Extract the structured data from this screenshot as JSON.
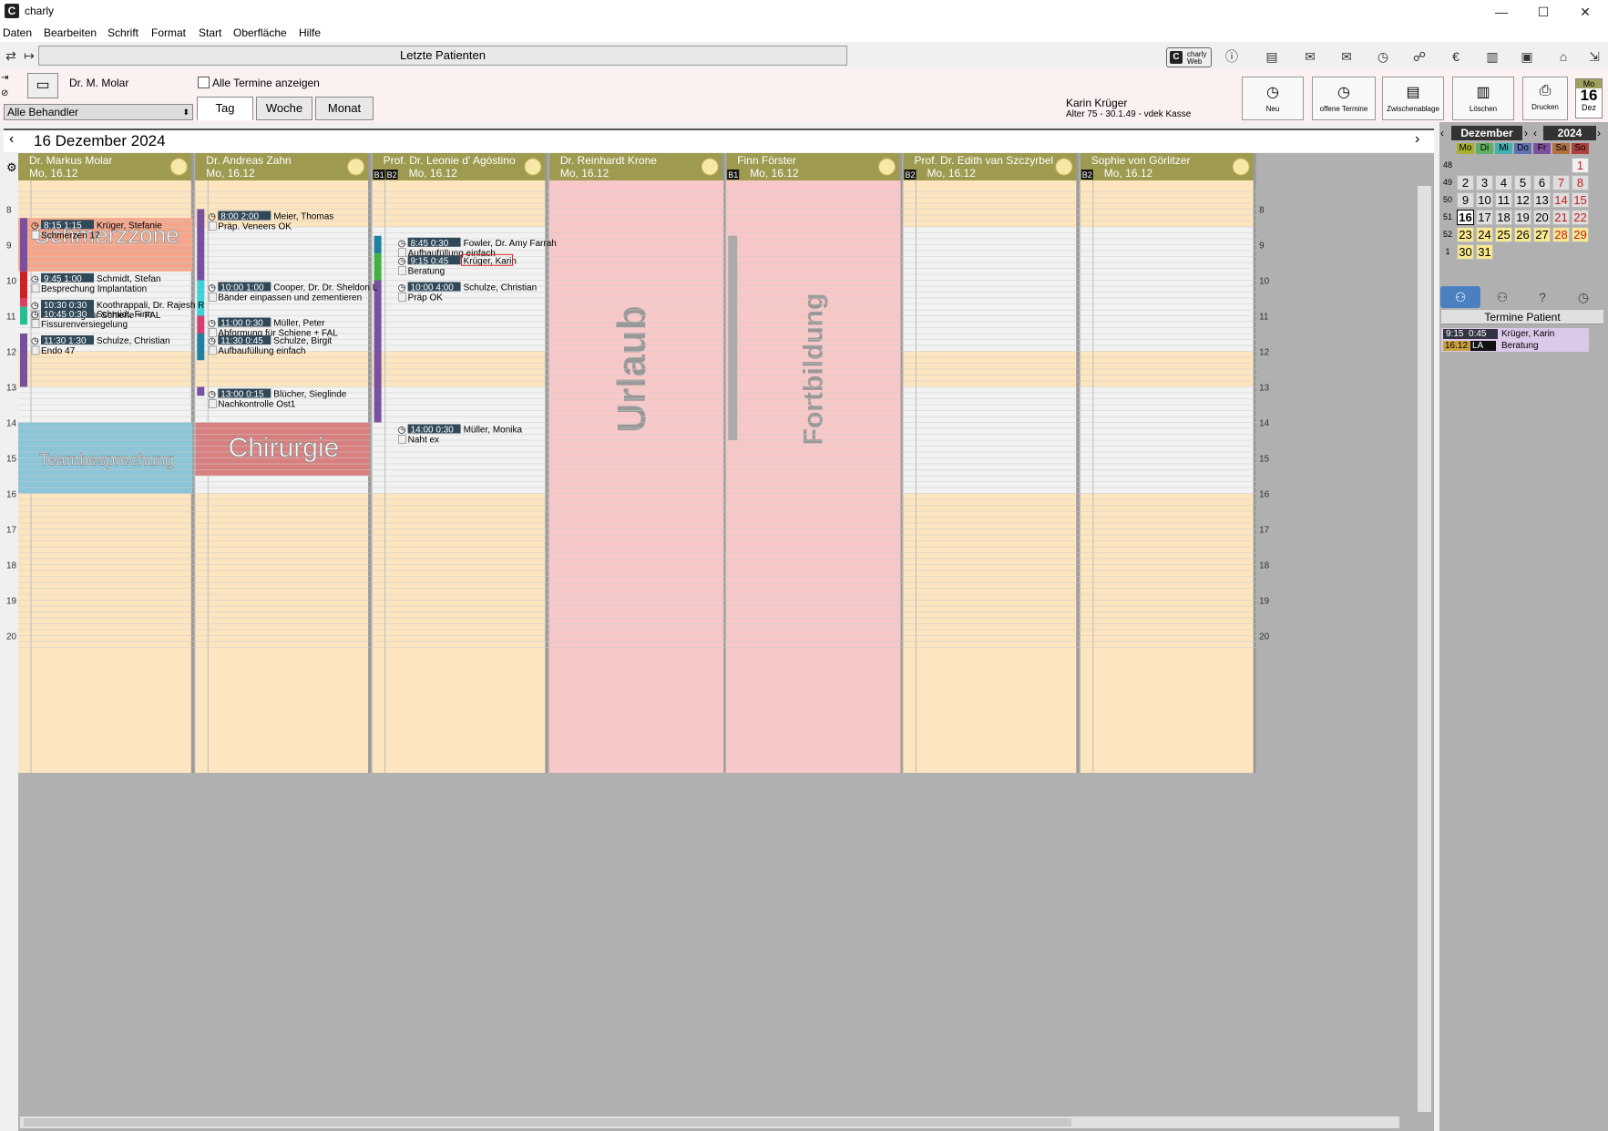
{
  "window": {
    "title": "charly",
    "logo": "C",
    "minimize": "—",
    "maximize": "☐",
    "close": "✕"
  },
  "menu": [
    "Daten",
    "Bearbeiten",
    "Schrift",
    "Format",
    "Start",
    "Oberfläche",
    "Hilfe"
  ],
  "toolbar": {
    "recent_patients": "Letzte Patienten",
    "charly_web_line1": "charly",
    "charly_web_line2": "Web"
  },
  "controls": {
    "doctor": "Dr. M. Molar",
    "behandler_select": "Alle Behandler",
    "show_all_label": "Alle Termine anzeigen",
    "tabs": [
      "Tag",
      "Woche",
      "Monat"
    ],
    "active_tab": "Tag"
  },
  "patient": {
    "name": "Karin Krüger",
    "info": "Alter 75 - 30.1.49 - vdek Kasse"
  },
  "actions": [
    {
      "label": "Neu",
      "icon": "clock-plus-icon"
    },
    {
      "label": "offene Termine",
      "icon": "clock-question-icon"
    },
    {
      "label": "Zwischenablage",
      "icon": "clipboard-icon"
    },
    {
      "label": "Löschen",
      "icon": "trash-icon"
    },
    {
      "label": "Drucken",
      "icon": "printer-icon"
    }
  ],
  "date_badge": {
    "dow": "Mo",
    "day": "16",
    "month": "Dez"
  },
  "calendar": {
    "date_title": "16 Dezember 2024",
    "hours": [
      "8",
      "9",
      "10",
      "11",
      "12",
      "13",
      "14",
      "15",
      "16",
      "17",
      "18",
      "19",
      "20"
    ],
    "columns": [
      {
        "name": "Dr. Markus Molar",
        "date": "Mo, 16.12",
        "badges": []
      },
      {
        "name": "Dr. Andreas Zahn",
        "date": "Mo, 16.12",
        "badges": []
      },
      {
        "name": "Prof. Dr. Leonie d' Agóstino",
        "date": "Mo, 16.12",
        "badges": [
          "B1",
          "B2"
        ]
      },
      {
        "name": "Dr. Reinhardt Krone",
        "date": "Mo, 16.12",
        "badges": []
      },
      {
        "name": "Finn Förster",
        "date": "Mo, 16.12",
        "badges": [
          "B1"
        ]
      },
      {
        "name": "Prof. Dr. Edith van Szczyrbel",
        "date": "Mo, 16.12",
        "badges": [
          "B2"
        ]
      },
      {
        "name": "Sophie von Görlitzer",
        "date": "Mo, 16.12",
        "badges": [
          "B2"
        ]
      }
    ],
    "blocks": [
      {
        "col": 0,
        "start": 8.25,
        "end": 9.75,
        "label": "Schmerzzone",
        "color": "#f4a58a"
      },
      {
        "col": 0,
        "start": 14,
        "end": 16,
        "label": "Teambesprechung",
        "color": "#8cc4d8"
      },
      {
        "col": 1,
        "start": 14,
        "end": 15.5,
        "label": "Chirurgie",
        "color": "#d88080"
      },
      {
        "col": 3,
        "start": 7,
        "end": 24,
        "label": "Urlaub",
        "color": "#f8c8c8"
      },
      {
        "col": 4,
        "start": 7,
        "end": 24,
        "label": "Fortbildung",
        "color": "#f8c8c8"
      }
    ],
    "appointments": [
      {
        "col": 0,
        "start": 8.25,
        "time": "8:15",
        "dur": "1:15",
        "patient": "Krüger, Stefanie",
        "text": "Schmerzen 17"
      },
      {
        "col": 0,
        "start": 9.75,
        "time": "9:45",
        "dur": "1:00",
        "patient": "Schmidt, Stefan",
        "text": "Besprechung Implantation"
      },
      {
        "col": 0,
        "start": 10.5,
        "time": "10:30",
        "dur": "0:30",
        "patient": "Koothrappali, Dr. Rajesh R",
        "text": "Abformung für Schiene + FAL"
      },
      {
        "col": 0,
        "start": 10.75,
        "time": "10:45",
        "dur": "0:30",
        "patient": "Schmidt, Finn",
        "text": "Fissurenversiegelung"
      },
      {
        "col": 0,
        "start": 11.5,
        "time": "11:30",
        "dur": "1:30",
        "patient": "Schulze, Christian",
        "text": "Endo 47"
      },
      {
        "col": 1,
        "start": 8,
        "time": "8:00",
        "dur": "2:00",
        "patient": "Meier, Thomas",
        "text": "Präp. Veneers OK"
      },
      {
        "col": 1,
        "start": 10,
        "time": "10:00",
        "dur": "1:00",
        "patient": "Cooper, Dr. Dr. Sheldon L",
        "text": "Bänder einpassen und zementieren"
      },
      {
        "col": 1,
        "start": 11,
        "time": "11:00",
        "dur": "0:30",
        "patient": "Müller, Peter",
        "text": "Abformung für Schiene + FAL"
      },
      {
        "col": 1,
        "start": 11.5,
        "time": "11:30",
        "dur": "0:45",
        "patient": "Schulze, Birgit",
        "text": "Aufbaufüllung einfach"
      },
      {
        "col": 1,
        "start": 13,
        "time": "13:00",
        "dur": "0:15",
        "patient": "Blücher, Sieglinde",
        "text": "Nachkontrolle Ost1"
      },
      {
        "col": 2,
        "start": 8.75,
        "time": "8:45",
        "dur": "0:30",
        "patient": "Fowler, Dr. Amy Farrah",
        "text": "Aufbaufüllung einfach"
      },
      {
        "col": 2,
        "start": 9.25,
        "time": "9:15",
        "dur": "0:45",
        "patient": "Krüger, Karin",
        "text": "Beratung"
      },
      {
        "col": 2,
        "start": 10,
        "time": "10:00",
        "dur": "4:00",
        "patient": "Schulze, Christian",
        "text": "Präp OK"
      },
      {
        "col": 2,
        "start": 14,
        "time": "14:00",
        "dur": "0:30",
        "patient": "Müller, Monika",
        "text": "Naht ex"
      }
    ]
  },
  "mini_calendar": {
    "month": "Dezember",
    "year": "2024",
    "weekdays": [
      "Mo",
      "Di",
      "Mi",
      "Do",
      "Fr",
      "Sa",
      "So"
    ],
    "weeks": [
      {
        "kw": "48",
        "days": [
          "",
          "",
          "",
          "",
          "",
          "",
          "1"
        ]
      },
      {
        "kw": "49",
        "days": [
          "2",
          "3",
          "4",
          "5",
          "6",
          "7",
          "8"
        ]
      },
      {
        "kw": "50",
        "days": [
          "9",
          "10",
          "11",
          "12",
          "13",
          "14",
          "15"
        ]
      },
      {
        "kw": "51",
        "days": [
          "16",
          "17",
          "18",
          "19",
          "20",
          "21",
          "22"
        ]
      },
      {
        "kw": "52",
        "days": [
          "23",
          "24",
          "25",
          "26",
          "27",
          "28",
          "29"
        ]
      },
      {
        "kw": "1",
        "days": [
          "30",
          "31",
          "",
          "",
          "",
          "",
          ""
        ]
      }
    ]
  },
  "right_panel": {
    "title": "Termine Patient",
    "item": {
      "time": "9:15",
      "dur": "0:45",
      "date": "16.12",
      "code": "LA",
      "patient": "Krüger, Karin",
      "text": "Beratung"
    }
  }
}
